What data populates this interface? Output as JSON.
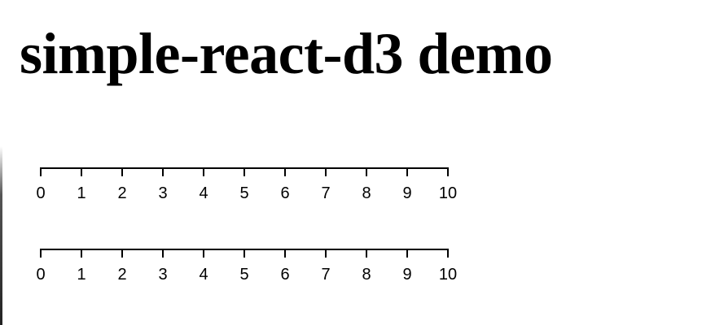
{
  "page": {
    "title": "simple-react-d3 demo"
  },
  "axes": [
    {
      "domain": [
        0,
        10
      ],
      "ticks": [
        "0",
        "1",
        "2",
        "3",
        "4",
        "5",
        "6",
        "7",
        "8",
        "9",
        "10"
      ]
    },
    {
      "domain": [
        0,
        10
      ],
      "ticks": [
        "0",
        "1",
        "2",
        "3",
        "4",
        "5",
        "6",
        "7",
        "8",
        "9",
        "10"
      ]
    }
  ],
  "colors": {
    "axis": "#000000",
    "background": "#ffffff"
  }
}
